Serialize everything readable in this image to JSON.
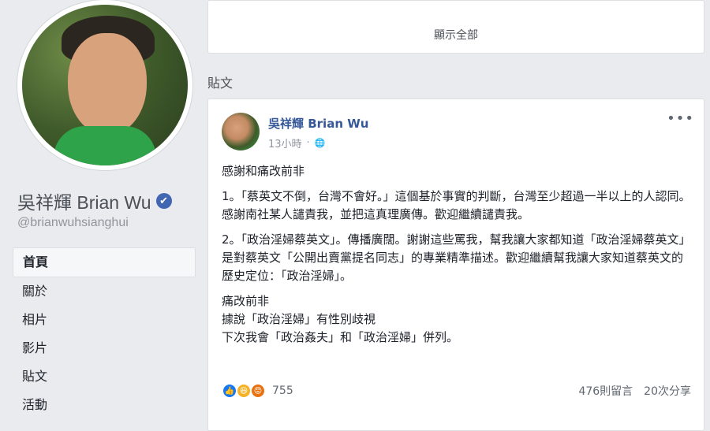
{
  "profile": {
    "name": "吳祥輝 Brian Wu",
    "handle": "@brianwuhsianghui",
    "verified_icon": "✔"
  },
  "nav": {
    "items": [
      {
        "label": "首頁"
      },
      {
        "label": "關於"
      },
      {
        "label": "相片"
      },
      {
        "label": "影片"
      },
      {
        "label": "貼文"
      },
      {
        "label": "活動"
      }
    ]
  },
  "top_card": {
    "show_all": "顯示全部"
  },
  "section": {
    "title": "貼文"
  },
  "post": {
    "author": "吳祥輝 Brian Wu",
    "time": "13小時",
    "privacy_icon": "🌐",
    "more_icon": "•••",
    "paragraphs": [
      "感謝和痛改前非",
      "1。「蔡英文不倒，台灣不會好。」這個基於事實的判斷，台灣至少超過一半以上的人認同。感謝南社某人譴責我，並把這真理廣傳。歡迎繼續譴責我。",
      "2。「政治淫婦蔡英文」。傳播廣闊。謝謝這些罵我，幫我讓大家都知道「政治淫婦蔡英文」是對蔡英文「公開出賣黨提名同志」的專業精準描述。歡迎繼續幫我讓大家知道蔡英文的歷史定位：「政治淫婦」。",
      "痛改前非\n據說「政治淫婦」有性別歧視\n下次我會「政治姦夫」和「政治淫婦」併列。"
    ],
    "reactions_count": "755",
    "comments": "476則留言",
    "shares": "20次分享"
  }
}
